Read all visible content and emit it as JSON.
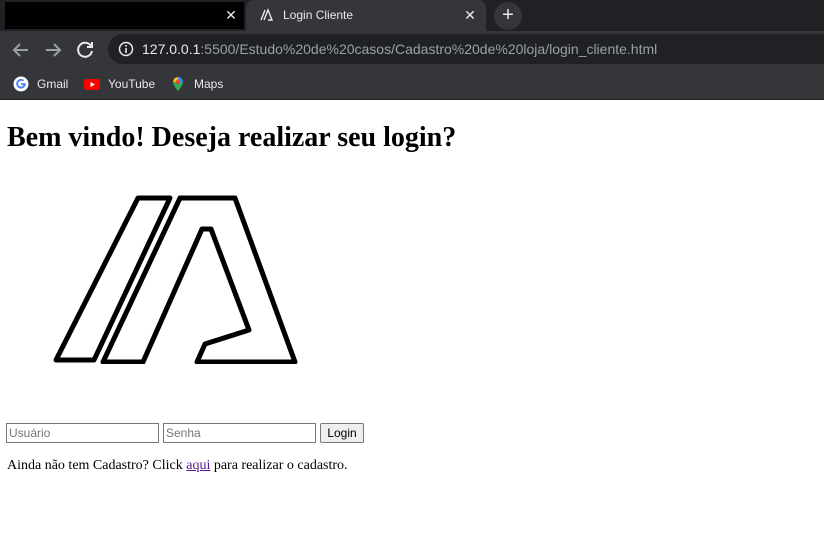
{
  "browser": {
    "tabs": [
      {
        "title": "",
        "active": false
      },
      {
        "title": "Login Cliente",
        "active": true
      }
    ],
    "new_tab_symbol": "+",
    "close_symbol": "✕",
    "url_host": "127.0.0.1",
    "url_rest": ":5500/Estudo%20de%20casos/Cadastro%20de%20loja/login_cliente.html",
    "bookmarks": [
      {
        "label": "Gmail",
        "icon": "google-icon"
      },
      {
        "label": "YouTube",
        "icon": "youtube-icon"
      },
      {
        "label": "Maps",
        "icon": "maps-pin-icon"
      }
    ]
  },
  "page": {
    "heading": "Bem vindo! Deseja realizar seu login?",
    "logo": "logo-icon",
    "form": {
      "username_placeholder": "Usuário",
      "password_placeholder": "Senha",
      "submit_label": "Login"
    },
    "signup": {
      "before": "Ainda não tem Cadastro? Click ",
      "link": "aqui",
      "after": " para realizar o cadastro."
    }
  },
  "colors": {
    "chrome_dark": "#202124",
    "chrome_toolbar": "#35363a",
    "link_visited": "#551a8b"
  }
}
